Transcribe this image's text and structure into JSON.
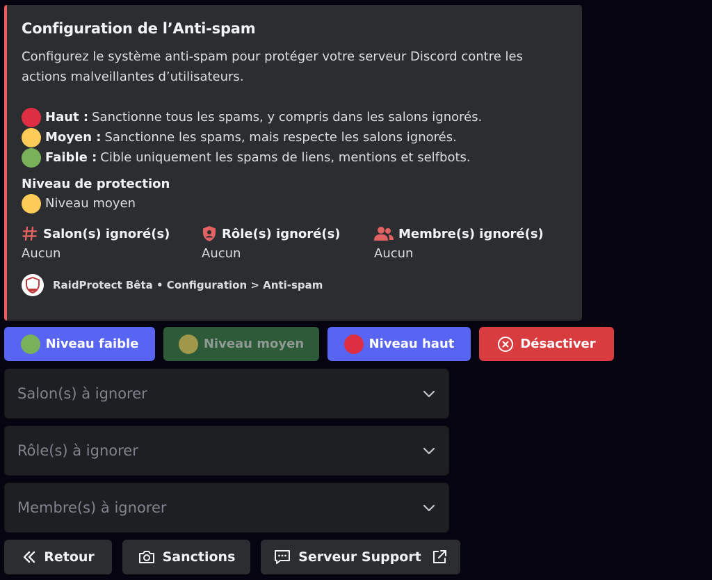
{
  "embed": {
    "title": "Configuration de l’Anti-spam",
    "description": "Configurez le système anti-spam pour protéger votre serveur Discord contre les actions malveillantes d’utilisateurs.",
    "accent_color": "#e85d5d",
    "levels": [
      {
        "emoji": "red-circle",
        "name": "Haut :",
        "text": "Sanctionne tous les spams, y compris dans les salons ignorés."
      },
      {
        "emoji": "yellow-circle",
        "name": "Moyen :",
        "text": "Sanctionne les spams, mais respecte les salons ignorés."
      },
      {
        "emoji": "green-circle",
        "name": "Faible :",
        "text": "Cible uniquement les spams de liens, mentions et selfbots."
      }
    ],
    "protection": {
      "label": "Niveau de protection",
      "value": "Niveau moyen",
      "emoji": "yellow-circle"
    },
    "fields": [
      {
        "icon": "hashtag-icon",
        "name": "Salon(s) ignoré(s)",
        "value": "Aucun"
      },
      {
        "icon": "shield-user-icon",
        "name": "Rôle(s) ignoré(s)",
        "value": "Aucun"
      },
      {
        "icon": "users-icon",
        "name": "Membre(s) ignoré(s)",
        "value": "Aucun"
      }
    ],
    "footer": "RaidProtect Bêta • Configuration > Anti-spam"
  },
  "buttons": {
    "low": "Niveau faible",
    "medium": "Niveau moyen",
    "high": "Niveau haut",
    "disable": "Désactiver"
  },
  "selects": [
    {
      "placeholder": "Salon(s) à ignorer"
    },
    {
      "placeholder": "Rôle(s) à ignorer"
    },
    {
      "placeholder": "Membre(s) à ignorer"
    }
  ],
  "nav": {
    "back": "Retour",
    "sanctions": "Sanctions",
    "support": "Serveur Support"
  },
  "colors": {
    "blurple": "#5865f2",
    "danger": "#d83c3e",
    "success_disabled": "#2d5a39",
    "red": "#dd2e44",
    "yellow": "#fdcb58",
    "green": "#78b159"
  }
}
